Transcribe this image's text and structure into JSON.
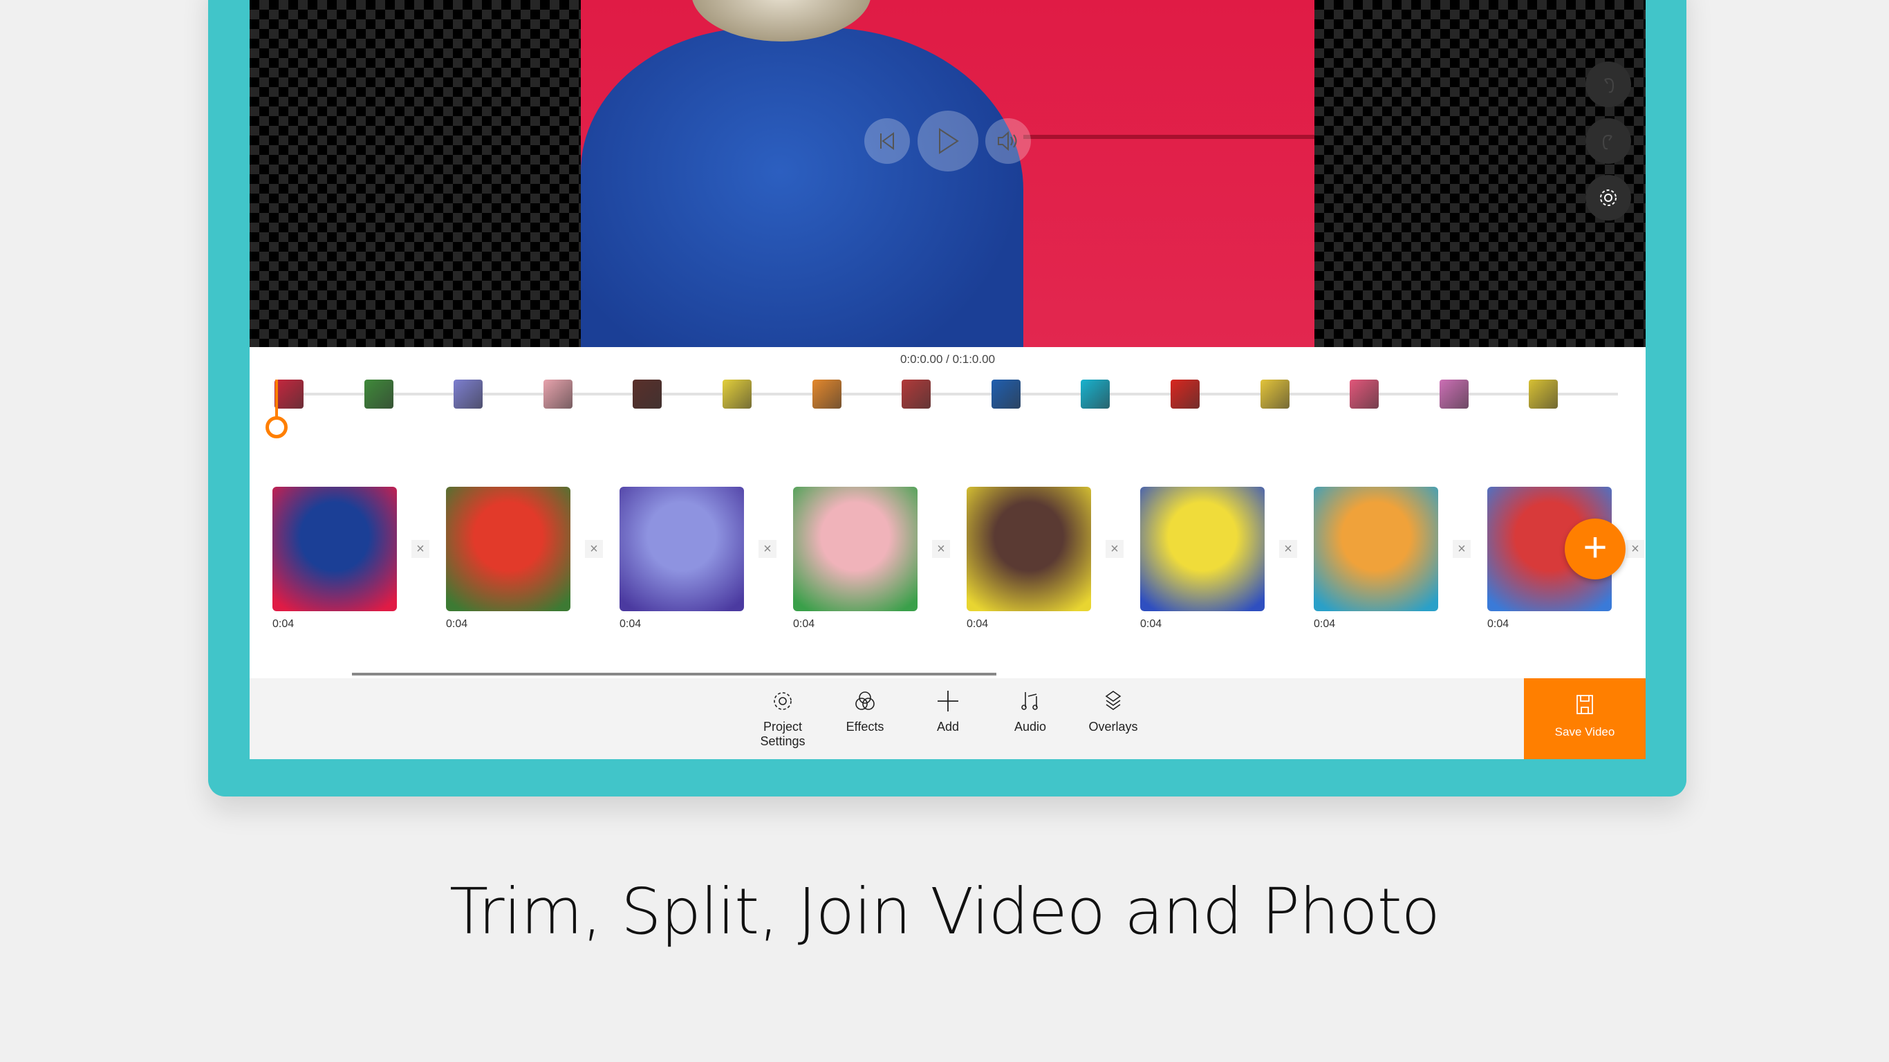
{
  "player": {
    "timecode": "0:0:0.00 / 0:1:0.00"
  },
  "colors": {
    "accent": "#ff7f00",
    "frame": "#41c5c9"
  },
  "mini_thumbs": [
    "#c8263e",
    "#3f8a3a",
    "#7d7fd0",
    "#e8a3ad",
    "#5a2f2a",
    "#e3cf3a",
    "#e4882c",
    "#b23a3a",
    "#1f5fb0",
    "#18b3cf",
    "#d9261f",
    "#e3c43a",
    "#e2567a",
    "#cc6fb5",
    "#d7c033"
  ],
  "clips": [
    {
      "duration": "0:04",
      "color1": "#1b3f96",
      "color2": "#e01b45"
    },
    {
      "duration": "0:04",
      "color1": "#e23a2a",
      "color2": "#3d7a33"
    },
    {
      "duration": "0:04",
      "color1": "#8e93e0",
      "color2": "#4b3aa0"
    },
    {
      "duration": "0:04",
      "color1": "#f0b3ba",
      "color2": "#3aa04a"
    },
    {
      "duration": "0:04",
      "color1": "#5a3a33",
      "color2": "#e8d531"
    },
    {
      "duration": "0:04",
      "color1": "#f0dc3a",
      "color2": "#2f4fc0"
    },
    {
      "duration": "0:04",
      "color1": "#f0a23a",
      "color2": "#2aa0c8"
    },
    {
      "duration": "0:04",
      "color1": "#d83a3a",
      "color2": "#3a7ad8"
    }
  ],
  "toolbar": {
    "project_settings": "Project Settings",
    "effects": "Effects",
    "add": "Add",
    "audio": "Audio",
    "overlays": "Overlays",
    "save_video": "Save Video"
  },
  "caption": "Trim, Split, Join Video and Photo"
}
